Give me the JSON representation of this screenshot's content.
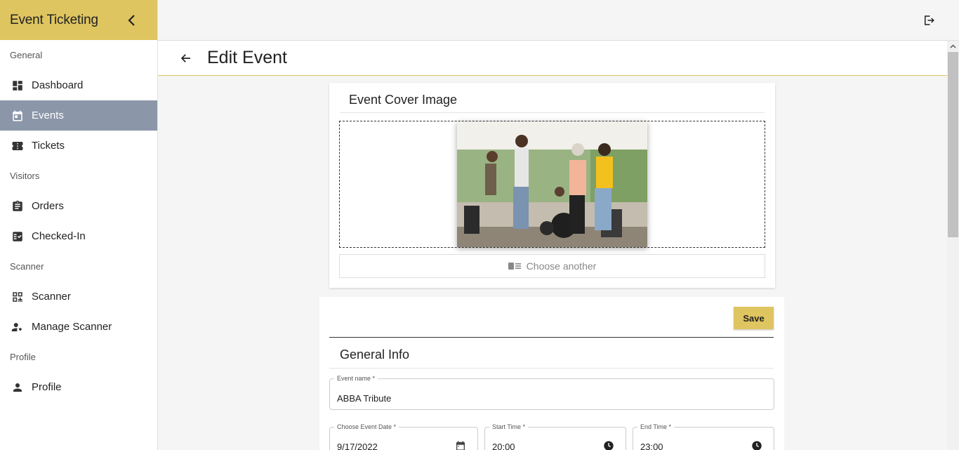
{
  "app": {
    "title": "Event Ticketing"
  },
  "sidebar": {
    "sections": {
      "general": "General",
      "visitors": "Visitors",
      "scanner": "Scanner",
      "profile": "Profile"
    },
    "items": {
      "dashboard": "Dashboard",
      "events": "Events",
      "tickets": "Tickets",
      "orders": "Orders",
      "checked_in": "Checked-In",
      "scanner": "Scanner",
      "manage_scanner": "Manage Scanner",
      "profile": "Profile"
    },
    "active_item": "events"
  },
  "page": {
    "title": "Edit Event"
  },
  "cover": {
    "title": "Event Cover Image",
    "choose_label": "Choose another"
  },
  "toolbar": {
    "save_label": "Save"
  },
  "general_info": {
    "title": "General Info",
    "event_name": {
      "label": "Event name *",
      "value": "ABBA Tribute"
    },
    "event_date": {
      "label": "Choose Event Date *",
      "value": "9/17/2022"
    },
    "start_time": {
      "label": "Start Time *",
      "value": "20:00"
    },
    "end_time": {
      "label": "End Time *",
      "value": "23:00"
    }
  },
  "colors": {
    "accent": "#dfc560",
    "active_nav": "#8b96a8"
  }
}
